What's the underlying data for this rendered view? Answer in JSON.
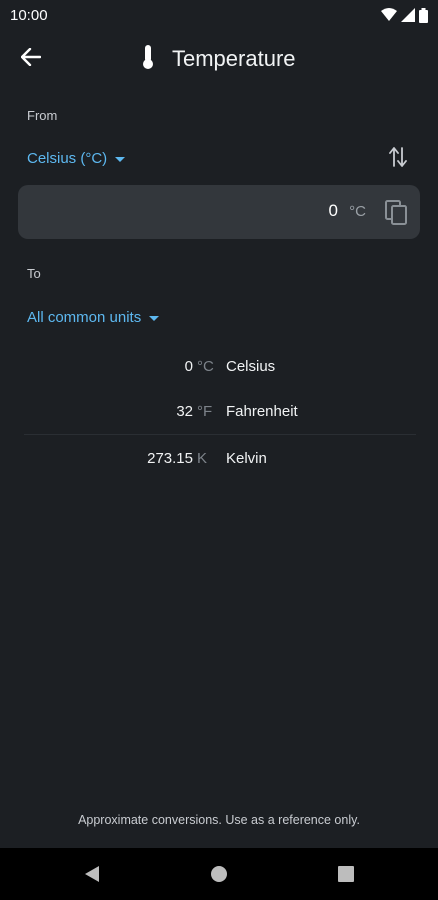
{
  "status_bar": {
    "time": "10:00"
  },
  "toolbar": {
    "title": "Temperature",
    "back_icon": "arrow-left-icon",
    "title_icon": "thermometer-icon"
  },
  "from": {
    "label": "From",
    "unit_selected": "Celsius (°C)",
    "input_value": "0",
    "input_unit": "°C"
  },
  "to": {
    "label": "To",
    "unit_selected": "All common units"
  },
  "results": [
    {
      "value": "0",
      "unit": "°C",
      "name": "Celsius"
    },
    {
      "value": "32",
      "unit": "°F",
      "name": "Fahrenheit"
    },
    {
      "value": "273.15",
      "unit": "K",
      "name": "Kelvin"
    }
  ],
  "footer": {
    "note": "Approximate conversions. Use as a reference only."
  },
  "colors": {
    "accent": "#5db8f0",
    "background": "#1c1f23",
    "card": "#33373c"
  }
}
